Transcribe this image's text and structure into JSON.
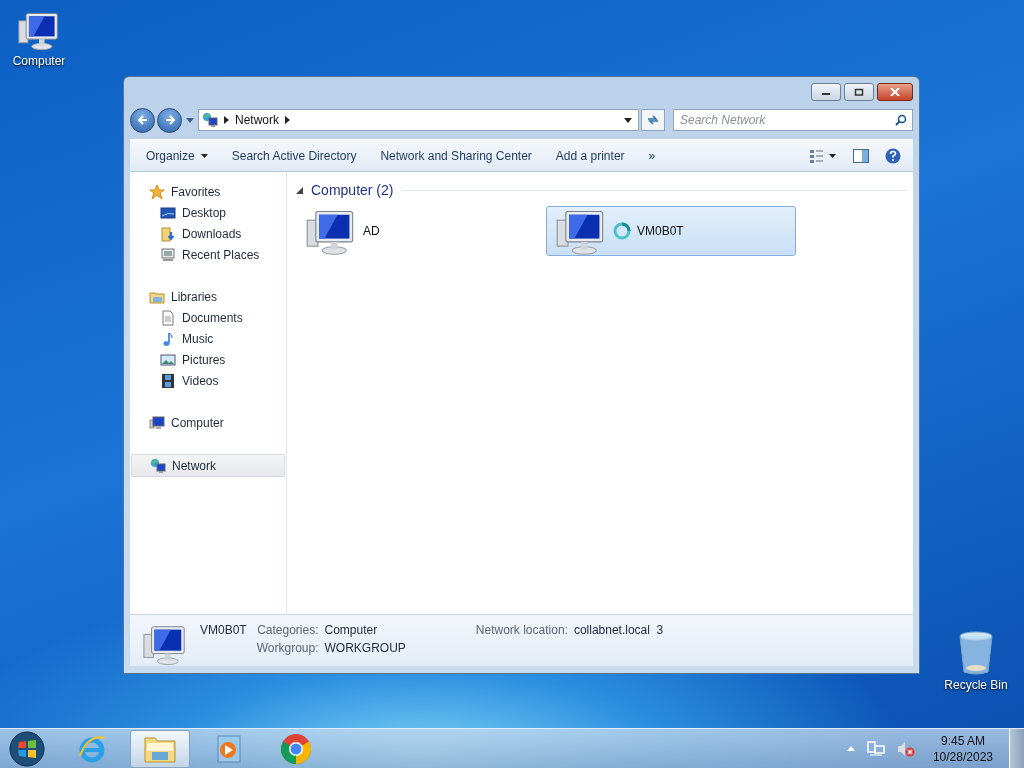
{
  "desktop_icons": [
    {
      "label": "Computer",
      "kind": "computer"
    },
    {
      "label": "Recycle Bin",
      "kind": "recycle"
    }
  ],
  "window": {
    "address": {
      "crumbs": [
        "Network"
      ]
    },
    "search": {
      "placeholder": "Search Network"
    },
    "toolbar": {
      "commands": [
        {
          "label": "Organize",
          "dropdown": true
        },
        {
          "label": "Search Active Directory",
          "dropdown": false
        },
        {
          "label": "Network and Sharing Center",
          "dropdown": false
        },
        {
          "label": "Add a printer",
          "dropdown": false
        }
      ],
      "overflow": "»"
    },
    "nav": [
      {
        "label": "Favorites",
        "kind": "star",
        "selected": false,
        "children": [
          {
            "label": "Desktop",
            "kind": "desktop",
            "selected": false
          },
          {
            "label": "Downloads",
            "kind": "downloads",
            "selected": false
          },
          {
            "label": "Recent Places",
            "kind": "recent",
            "selected": false
          }
        ]
      },
      {
        "label": "Libraries",
        "kind": "library",
        "selected": false,
        "children": [
          {
            "label": "Documents",
            "kind": "document",
            "selected": false
          },
          {
            "label": "Music",
            "kind": "music",
            "selected": false
          },
          {
            "label": "Pictures",
            "kind": "pictures",
            "selected": false
          },
          {
            "label": "Videos",
            "kind": "videos",
            "selected": false
          }
        ]
      },
      {
        "label": "Computer",
        "kind": "computer",
        "selected": false
      },
      {
        "label": "Network",
        "kind": "network",
        "selected": true
      }
    ],
    "group": {
      "label": "Computer (2)",
      "expanded": true
    },
    "items": [
      {
        "label": "AD",
        "selected": false,
        "busy": false
      },
      {
        "label": "VM0B0T",
        "selected": true,
        "busy": true
      }
    ],
    "details": {
      "name": "VM0B0T",
      "columns": [
        [
          {
            "label": "Categories:",
            "value": "Computer"
          },
          {
            "label": "Workgroup:",
            "value": "WORKGROUP"
          }
        ],
        [
          {
            "label": "Network location:",
            "value": "collabnet.local  3"
          }
        ]
      ]
    }
  },
  "taskbar": {
    "apps": [
      {
        "kind": "browser-e",
        "selected": false
      },
      {
        "kind": "folder",
        "selected": true
      },
      {
        "kind": "media",
        "selected": false
      },
      {
        "kind": "browser-ring",
        "selected": false
      }
    ],
    "clock": {
      "time": "9:45 AM",
      "date": "10/28/2023"
    }
  }
}
